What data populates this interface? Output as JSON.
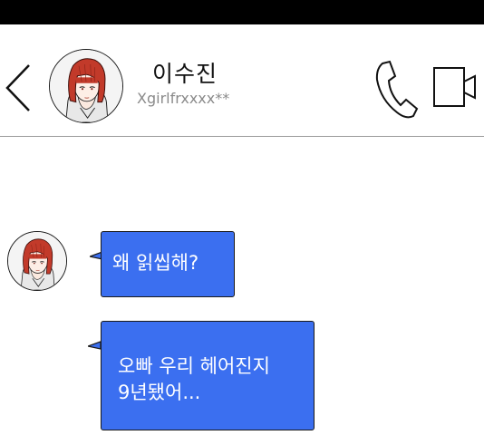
{
  "contact": {
    "name": "이수진",
    "handle": "Xgirlfrxxxx**"
  },
  "header": {
    "back_icon": "chevron-left-icon",
    "call_icon": "phone-icon",
    "video_icon": "video-camera-icon"
  },
  "messages": [
    {
      "sender": "이수진",
      "text": "왜 읽씹해?"
    },
    {
      "sender": "이수진",
      "text": "오빠 우리 헤어진지\n9년됐어..."
    }
  ],
  "colors": {
    "top_bar": "#000000",
    "bubble": "#3b6ff0",
    "bubble_text": "#ffffff",
    "handle_text": "#8a8a8a",
    "hair": "#c23a2a"
  }
}
